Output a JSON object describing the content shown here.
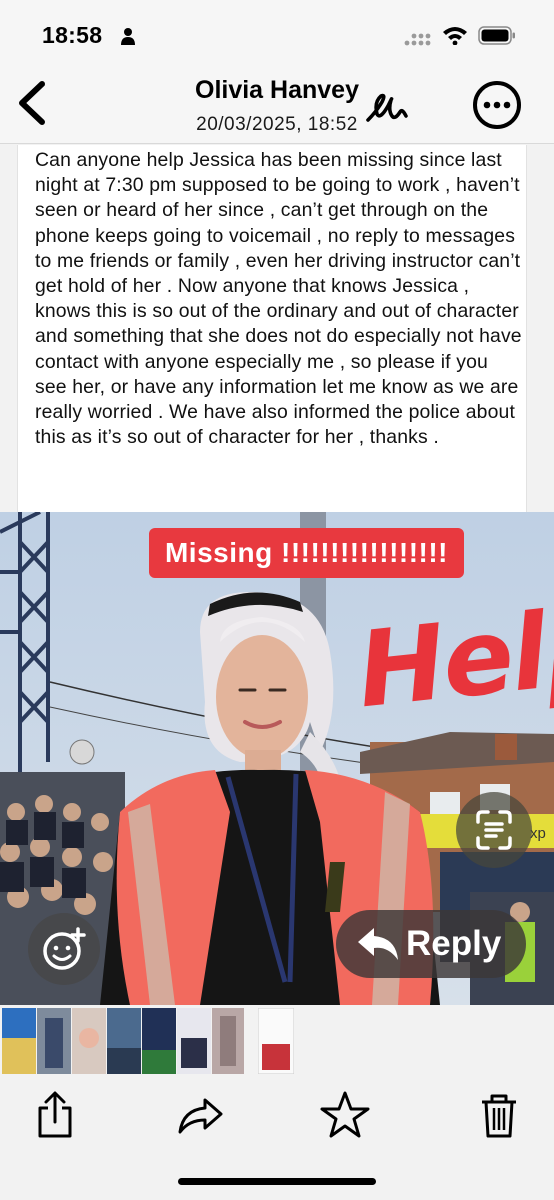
{
  "status_bar": {
    "time": "18:58",
    "icons": [
      "person-icon",
      "signal-icon",
      "wifi-icon",
      "battery-icon"
    ]
  },
  "header": {
    "sender": "Olivia Hanvey",
    "date": "20/03/2025, 18:52",
    "icons": [
      "chevron-left-icon",
      "markup-pen-icon",
      "more-icon"
    ]
  },
  "message": {
    "body": "Can anyone help Jessica has been missing since last night at 7:30 pm supposed to be going to work , haven’t seen or heard of her since , can’t get through on the phone keeps going to voicemail , no reply to messages to me friends or family , even her driving instructor can’t get hold of her . Now anyone that knows Jessica , knows this is so out of the ordinary and out of character and something that she does not do especially not have contact with anyone especially me , so please if you see her, or have any information let me know as we are really worried . We have also informed the police about this as it’s so out of character for her , thanks ."
  },
  "photo": {
    "banner": "Missing !!!!!!!!!!!!!!!!!",
    "overlay_text": "Help!",
    "background_sign": "xp",
    "colors": {
      "banner": "#e8393f",
      "help": "#e8343b",
      "vest": "#f26a5e"
    }
  },
  "actions": {
    "reply_label": "Reply",
    "react_icon": "smiley-plus-icon",
    "scan_icon": "live-text-scan-icon"
  },
  "toolbar": {
    "items": [
      "share-icon",
      "forward-icon",
      "star-icon",
      "trash-icon"
    ]
  }
}
